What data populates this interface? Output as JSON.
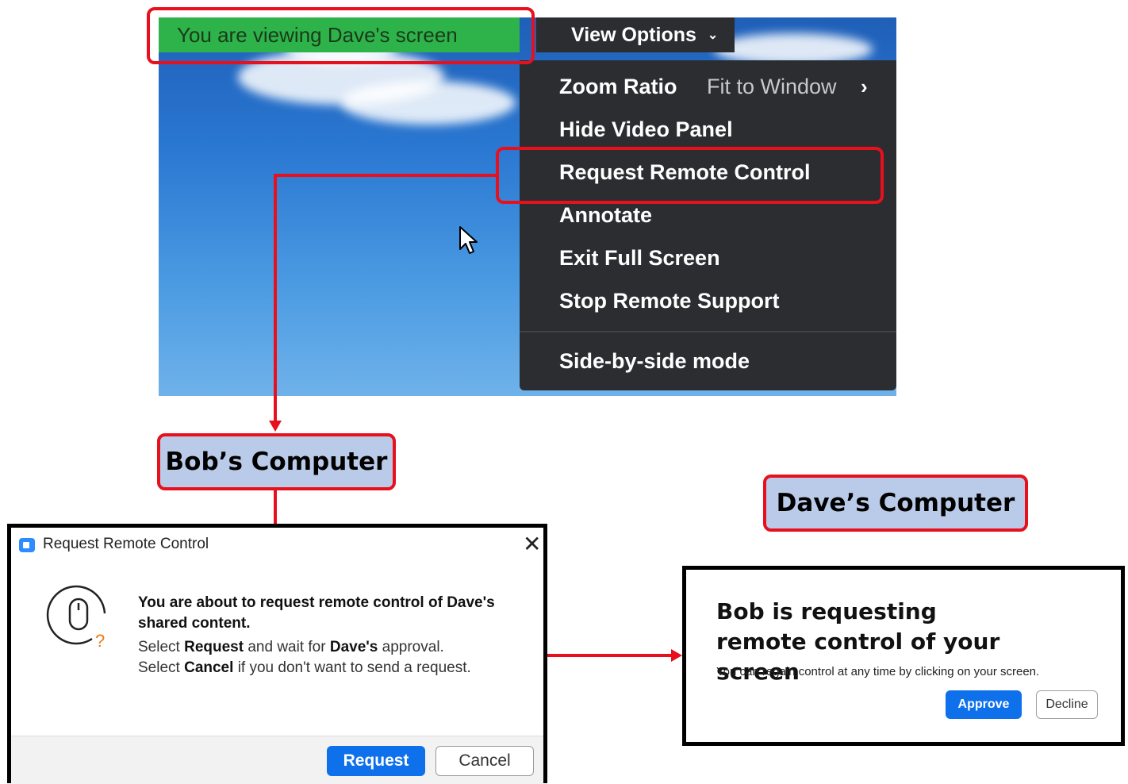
{
  "share": {
    "viewing_banner": "You are viewing Dave's screen",
    "view_options_label": "View Options"
  },
  "menu": {
    "items": [
      {
        "label": "Zoom Ratio",
        "value": "Fit to Window"
      },
      {
        "label": "Hide Video Panel"
      },
      {
        "label": "Request Remote Control"
      },
      {
        "label": "Annotate"
      },
      {
        "label": "Exit Full Screen"
      },
      {
        "label": "Stop Remote Support"
      },
      {
        "label": "Side-by-side mode"
      }
    ]
  },
  "labels": {
    "bob": "Bob’s Computer",
    "dave": "Dave’s Computer"
  },
  "bob_dialog": {
    "title": "Request Remote Control",
    "close": "✕",
    "heading_pre": "You are about to request remote control of",
    "heading_name": "Dave's",
    "heading_post": "shared content.",
    "line1_pre": "Select",
    "line1_bold": "Request",
    "line1_mid": "and wait for",
    "line1_name": "Dave's",
    "line1_post": "approval.",
    "line2_pre": "Select",
    "line2_bold": "Cancel",
    "line2_post": "if you don't want to send a request.",
    "request_button": "Request",
    "cancel_button": "Cancel"
  },
  "dave_dialog": {
    "heading": "Bob is requesting remote control of your screen",
    "body": "You can regain control at any time by clicking on your screen.",
    "approve_button": "Approve",
    "decline_button": "Decline"
  },
  "colors": {
    "accent_blue": "#0e71eb",
    "highlight_red": "#e8101c",
    "banner_green": "#2db34a",
    "menu_bg": "#2b2d30",
    "label_bg": "#b9cbe8"
  }
}
